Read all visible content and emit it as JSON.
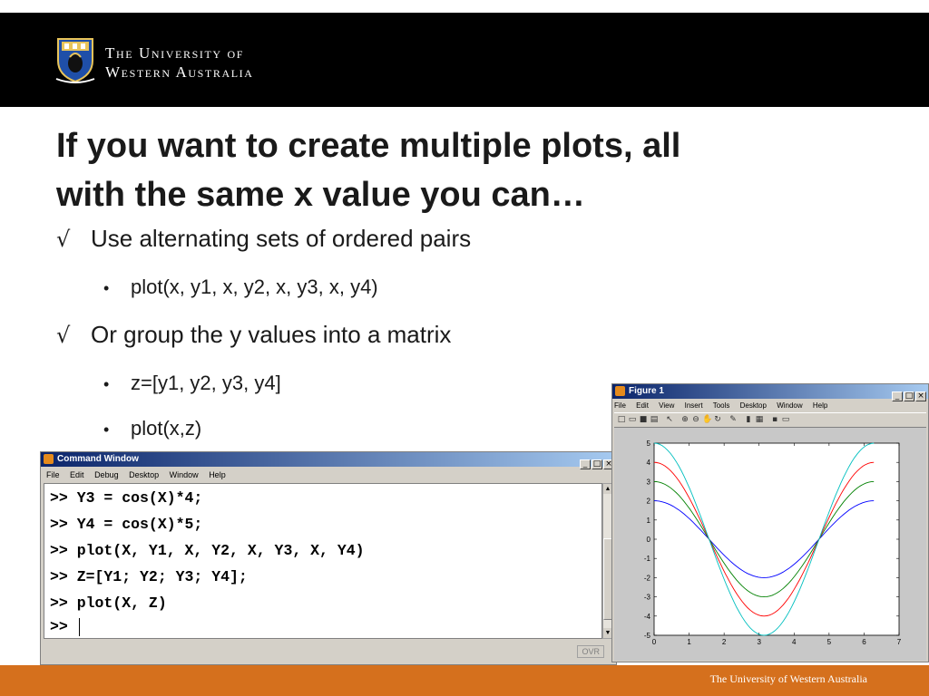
{
  "header": {
    "university_line1": "The University of",
    "university_line2": "Western Australia",
    "crest": "university-crest-icon"
  },
  "slide": {
    "title_line1": "If you want to create multiple plots, all",
    "title_line2": "with the same x value you can…",
    "bullets": [
      {
        "level": 1,
        "mark": "√",
        "text": "Use alternating sets of ordered pairs"
      },
      {
        "level": 2,
        "mark": "•",
        "text": "plot(x, y1, x, y2, x, y3, x, y4)"
      },
      {
        "level": 1,
        "mark": "√",
        "text": "Or group the y values into a matrix"
      },
      {
        "level": 2,
        "mark": "•",
        "text": "z=[y1, y2, y3, y4]"
      },
      {
        "level": 2,
        "mark": "•",
        "text": "plot(x,z)"
      }
    ]
  },
  "command_window": {
    "title": "Command Window",
    "menu": [
      "File",
      "Edit",
      "Debug",
      "Desktop",
      "Window",
      "Help"
    ],
    "lines": [
      ">> Y3 = cos(X)*4;",
      ">> Y4 = cos(X)*5;",
      ">> plot(X, Y1, X, Y2, X, Y3, X, Y4)",
      ">> Z=[Y1; Y2; Y3; Y4];",
      ">> plot(X, Z)",
      ">> "
    ],
    "status": "OVR"
  },
  "figure_window": {
    "title": "Figure 1",
    "menu": [
      "File",
      "Edit",
      "View",
      "Insert",
      "Tools",
      "Desktop",
      "Window",
      "Help"
    ]
  },
  "chart_data": {
    "type": "line",
    "title": "",
    "xlabel": "",
    "ylabel": "",
    "xlim": [
      0,
      7
    ],
    "ylim": [
      -5,
      5
    ],
    "xticks": [
      0,
      1,
      2,
      3,
      4,
      5,
      6,
      7
    ],
    "yticks": [
      5,
      4,
      3,
      2,
      1,
      0,
      -1,
      -2,
      -3,
      -4,
      -5
    ],
    "x_range": [
      0,
      6.28
    ],
    "grid": false,
    "series": [
      {
        "amplitude": 2,
        "expression": "cos(x)*2",
        "color": "#0000ff"
      },
      {
        "amplitude": 3,
        "expression": "cos(x)*3",
        "color": "#008000"
      },
      {
        "amplitude": 4,
        "expression": "cos(x)*4",
        "color": "#ff0000"
      },
      {
        "amplitude": 5,
        "expression": "cos(x)*5",
        "color": "#00bfbf"
      }
    ]
  },
  "footer": {
    "text": "The University of Western Australia",
    "color": "#d5701d"
  }
}
